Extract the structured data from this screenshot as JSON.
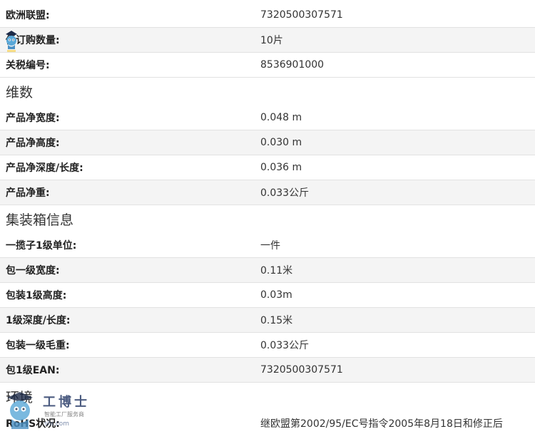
{
  "rows_top": [
    {
      "label": "欧洲联盟:",
      "value": "7320500307571"
    },
    {
      "label": "低订购数量:",
      "value": "10片"
    },
    {
      "label": "关税编号:",
      "value": "8536901000"
    }
  ],
  "section_dimensions": {
    "title": "维数",
    "rows": [
      {
        "label": "产品净宽度:",
        "value": "0.048 m"
      },
      {
        "label": "产品净高度:",
        "value": "0.030 m"
      },
      {
        "label": "产品净深度/长度:",
        "value": "0.036 m"
      },
      {
        "label": "产品净重:",
        "value": "0.033公斤"
      }
    ]
  },
  "section_container": {
    "title": "集装箱信息",
    "rows": [
      {
        "label": "一揽子1级单位:",
        "value": "一件"
      },
      {
        "label": "包一级宽度:",
        "value": "0.11米"
      },
      {
        "label": "包装1级高度:",
        "value": "0.03m"
      },
      {
        "label": "1级深度/长度:",
        "value": "0.15米"
      },
      {
        "label": "包装一级毛重:",
        "value": "0.033公斤"
      },
      {
        "label": "包1级EAN:",
        "value": "7320500307571"
      }
    ]
  },
  "section_environment": {
    "title": "环境",
    "rows": [
      {
        "label": "RoHS状况:",
        "value": "继欧盟第2002/95/EC号指令2005年8月18日和修正后"
      }
    ]
  },
  "watermark": {
    "brand": "工博士",
    "tagline": "智能工厂服务商",
    "url": "shi.com"
  },
  "colors": {
    "row_shade": "#f4f4f4",
    "divider": "#e2e2e2",
    "text": "#2a2a2a"
  }
}
